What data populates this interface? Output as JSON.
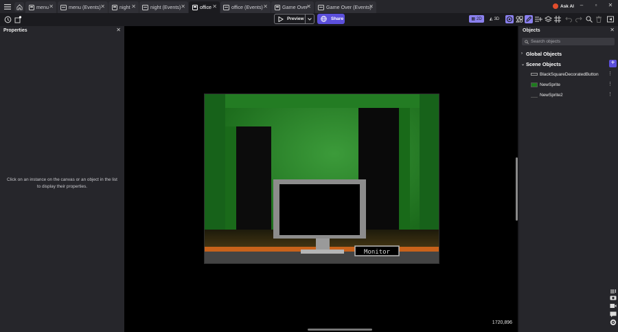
{
  "tabs": [
    {
      "label": "menu",
      "icon": "scene-icon",
      "active": false
    },
    {
      "label": "menu (Events)",
      "icon": "events-icon",
      "active": false
    },
    {
      "label": "night",
      "icon": "scene-icon",
      "active": false
    },
    {
      "label": "night (Events)",
      "icon": "events-icon",
      "active": false
    },
    {
      "label": "office",
      "icon": "scene-icon",
      "active": true
    },
    {
      "label": "office (Events)",
      "icon": "events-icon",
      "active": false
    },
    {
      "label": "Game Over",
      "icon": "scene-icon",
      "active": false
    },
    {
      "label": "Game Over (Events)",
      "icon": "events-icon",
      "active": false
    }
  ],
  "header": {
    "ask_ai": "Ask AI"
  },
  "toolbar": {
    "preview": "Preview",
    "share": "Share",
    "mode_2d": "2D",
    "mode_3d": "3D"
  },
  "properties": {
    "title": "Properties",
    "hint": "Click on an instance on the canvas or an object in the list to display their properties."
  },
  "canvas": {
    "coords": "1720,896",
    "scene_button": "Monitor"
  },
  "objects": {
    "title": "Objects",
    "search_placeholder": "Search objects",
    "global_group": "Global Objects",
    "scene_group": "Scene Objects",
    "items": [
      {
        "name": "BlackSquareDecoratedButton",
        "thumb": "button-thumb"
      },
      {
        "name": "NewSprite",
        "thumb": "green-sprite-thumb"
      },
      {
        "name": "NewSprite2",
        "thumb": "blank-thumb"
      }
    ]
  },
  "colors": {
    "accent": "#5b4fdb",
    "panel_bg": "#26262b",
    "canvas_bg": "#000000",
    "scene_wall": "#1c6e1c"
  }
}
